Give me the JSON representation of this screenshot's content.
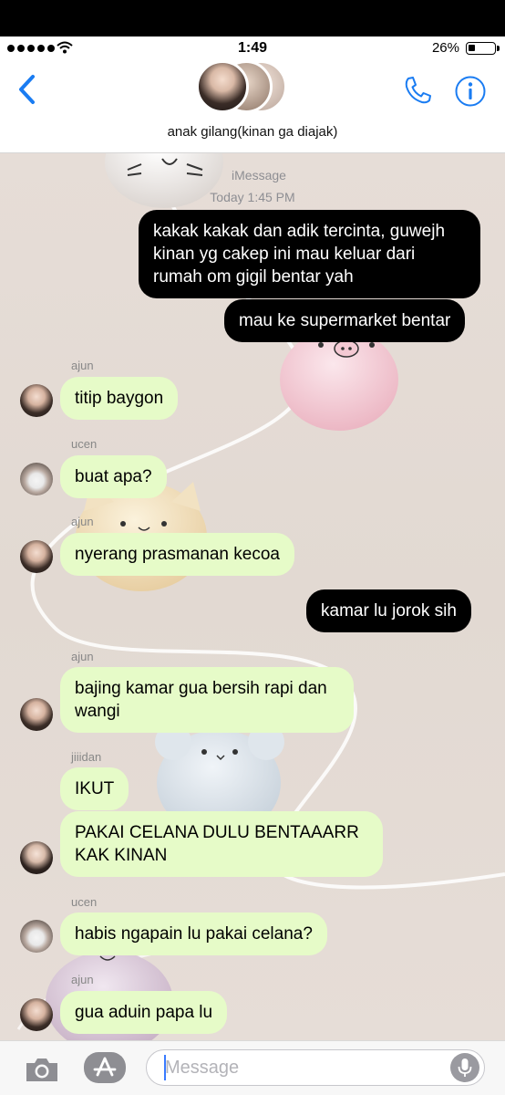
{
  "status": {
    "time": "1:49",
    "battery_pct": "26%",
    "battery_level": 0.26
  },
  "header": {
    "group_name": "anak gilang(kinan ga diajak)",
    "icons": {
      "back": "chevron-left-icon",
      "call": "phone-icon",
      "info": "info-icon"
    }
  },
  "chat": {
    "service_label": "iMessage",
    "timestamp": "Today 1:45 PM",
    "messages": [
      {
        "dir": "out",
        "text": "kakak kakak dan adik tercinta, guwejh kinan yg cakep ini mau keluar dari rumah om gigil bentar yah"
      },
      {
        "dir": "out",
        "text": "mau ke supermarket bentar"
      },
      {
        "dir": "in",
        "sender": "ajun",
        "text": "titip baygon"
      },
      {
        "dir": "in",
        "sender": "ucen",
        "text": "buat apa?"
      },
      {
        "dir": "in",
        "sender": "ajun",
        "text": "nyerang prasmanan kecoa"
      },
      {
        "dir": "out",
        "text": "kamar lu jorok sih"
      },
      {
        "dir": "in",
        "sender": "ajun",
        "text": "bajing kamar gua bersih rapi dan wangi"
      },
      {
        "dir": "in",
        "sender": "jiiidan",
        "text": "IKUT"
      },
      {
        "dir": "in",
        "text": "PAKAI CELANA DULU BENTAAARR KAK KINAN"
      },
      {
        "dir": "in",
        "sender": "ucen",
        "text": "habis ngapain lu pakai celana?"
      },
      {
        "dir": "in",
        "sender": "ajun",
        "text": "gua aduin papa lu"
      }
    ]
  },
  "composer": {
    "placeholder": "Message",
    "value": ""
  },
  "colors": {
    "accent": "#1a7cf2",
    "incoming_bubble": "#e6fbc8",
    "outgoing_bubble": "#000000"
  }
}
